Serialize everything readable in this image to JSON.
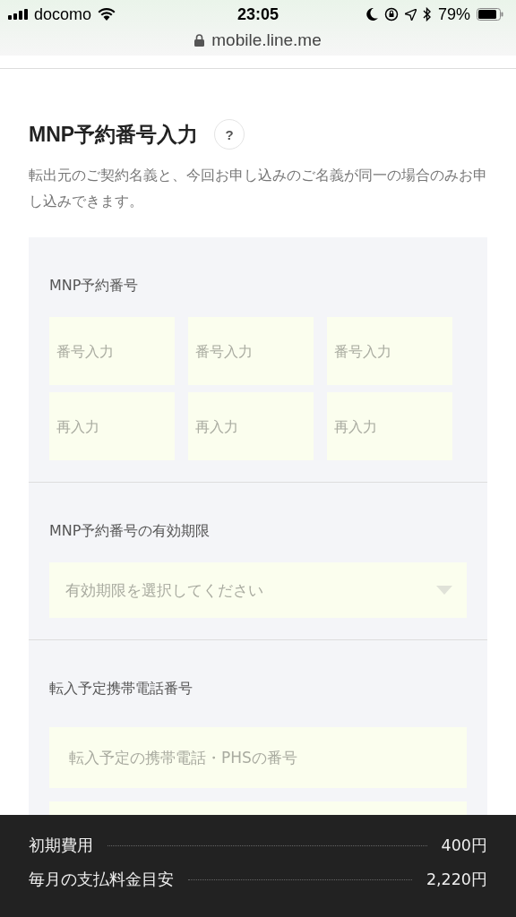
{
  "status_bar": {
    "carrier": "docomo",
    "time": "23:05",
    "battery": "79%"
  },
  "address_bar": {
    "url": "mobile.line.me"
  },
  "section": {
    "title": "MNP予約番号入力",
    "help": "?",
    "description": "転出元のご契約名義と、今回お申し込みのご名義が同一の場合のみお申し込みできます。"
  },
  "form": {
    "groups": [
      {
        "kind": "grid",
        "label": "MNP予約番号",
        "fields": [
          {
            "placeholder": "番号入力"
          },
          {
            "placeholder": "番号入力"
          },
          {
            "placeholder": "番号入力"
          },
          {
            "placeholder": "再入力"
          },
          {
            "placeholder": "再入力"
          },
          {
            "placeholder": "再入力"
          }
        ]
      },
      {
        "kind": "select",
        "label": "MNP予約番号の有効期限",
        "fields": [
          {
            "placeholder": "有効期限を選択してください"
          }
        ]
      },
      {
        "kind": "stack",
        "label": "転入予定携帯電話番号",
        "fields": [
          {
            "placeholder": "転入予定の携帯電話・PHSの番号"
          }
        ]
      }
    ]
  },
  "footer": {
    "rows": [
      {
        "label": "初期費用",
        "value": "400円"
      },
      {
        "label": "毎月の支払料金目安",
        "value": "2,220円"
      }
    ]
  }
}
